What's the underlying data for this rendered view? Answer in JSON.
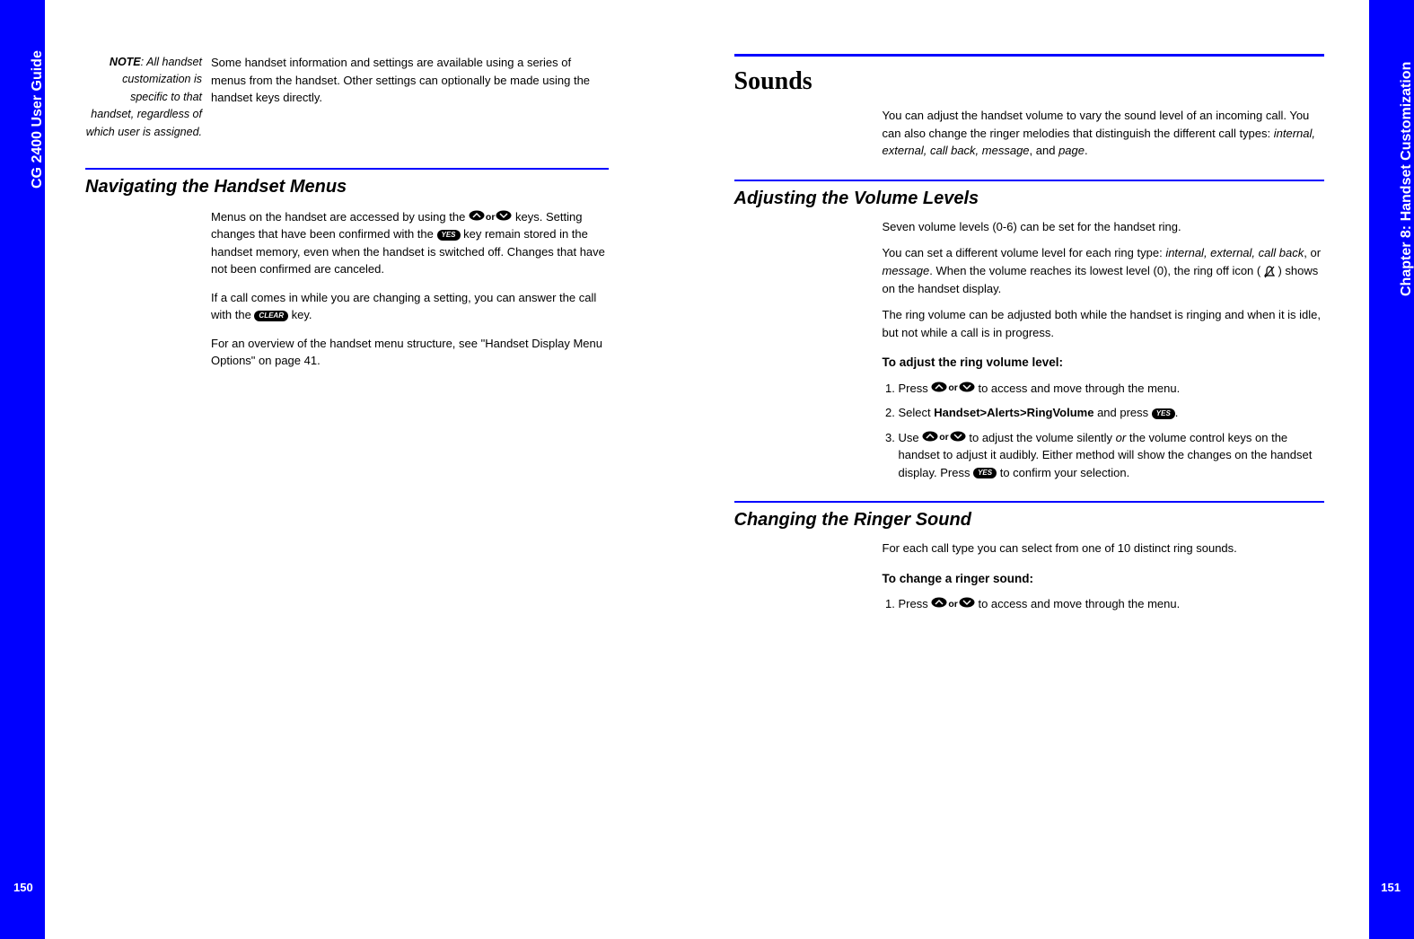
{
  "left": {
    "tab": "CG 2400 User Guide",
    "pagenum": "150",
    "note_label": "NOTE",
    "note_left": ": All handset customization is specific to that handset, regardless of which user is assigned.",
    "note_right": "Some handset information and settings are available using a series of menus from the handset. Other settings can optionally be made using the handset keys directly.",
    "sec1_title": "Navigating the Handset Menus",
    "sec1_p1a": "Menus on the handset are accessed by using the ",
    "sec1_p1b": " keys. Setting changes that have been confirmed with the ",
    "sec1_p1c": " key remain stored in the handset memory, even when the handset is switched off. Changes that have not been confirmed are canceled.",
    "sec1_p2a": "If a call comes in while you are changing a setting, you can answer the call with the ",
    "sec1_p2b": " key.",
    "sec1_p3": "For an overview of the handset menu structure, see \"Handset Display Menu Options\" on page 41."
  },
  "right": {
    "tab": "Chapter 8: Handset Customization",
    "pagenum": "151",
    "h1": "Sounds",
    "intro_a": "You can adjust the handset volume to vary the sound level of an incoming call. You can also change the ringer melodies that distinguish the different call types: ",
    "intro_types": "internal, external, call back, message",
    "intro_b": ", and ",
    "intro_c": "page",
    "intro_d": ".",
    "sec2_title": "Adjusting the Volume Levels",
    "sec2_p1": "Seven volume levels (0-6) can be set for the handset ring.",
    "sec2_p2a": "You can set a different volume level for each ring type: ",
    "sec2_p2_types": "internal, external, call back",
    "sec2_p2_or": ", or ",
    "sec2_p2_msg": "message",
    "sec2_p2b": ". When the volume reaches its lowest level (0), the ring off icon (",
    "sec2_p2c": ") shows on the handset display.",
    "sec2_p3": "The ring volume can be adjusted both while the handset is ringing and when it is idle, but not while a call is in progress.",
    "sec2_sub": "To adjust the ring volume level:",
    "sec2_s1a": "Press ",
    "sec2_s1b": " to access and move through the menu.",
    "sec2_s2a": "Select ",
    "sec2_s2_path": "Handset>Alerts>RingVolume",
    "sec2_s2b": " and press ",
    "sec2_s2c": ".",
    "sec2_s3a": "Use ",
    "sec2_s3b": " to adjust the volume silently ",
    "sec2_s3_or": "or",
    "sec2_s3c": " the volume control keys on the handset to adjust it audibly. Either method will show the changes on the handset display. Press ",
    "sec2_s3d": " to confirm your selection.",
    "sec3_title": "Changing the Ringer Sound",
    "sec3_p1": "For each call type you can select from one of 10 distinct ring sounds.",
    "sec3_sub": "To change a ringer sound:",
    "sec3_s1a": "Press ",
    "sec3_s1b": " to access and move through the menu."
  },
  "icons": {
    "or": "or",
    "yes": "YES",
    "clear": "CLEAR"
  }
}
